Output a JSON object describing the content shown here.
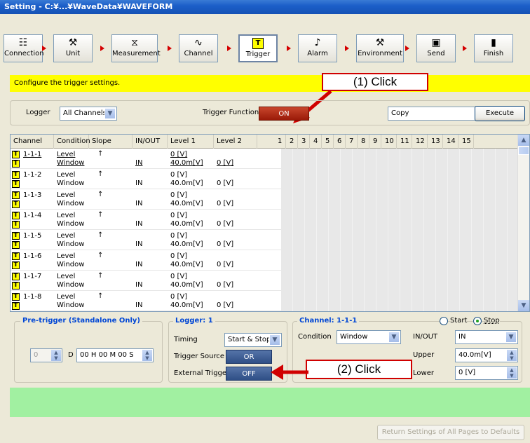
{
  "window": {
    "title": "Setting - C:¥...¥WaveData¥WAVEFORM"
  },
  "toolbar": {
    "items": [
      {
        "label": "Connection",
        "icon": "connection-icon",
        "glyph": "☷"
      },
      {
        "label": "Unit",
        "icon": "unit-icon",
        "glyph": "⚒"
      },
      {
        "label": "Measurement",
        "icon": "hourglass-icon",
        "glyph": "⧖"
      },
      {
        "label": "Channel",
        "icon": "waveform-icon",
        "glyph": "∿"
      },
      {
        "label": "Trigger",
        "icon": "trigger-icon",
        "glyph": "T"
      },
      {
        "label": "Alarm",
        "icon": "alarm-speaker-icon",
        "glyph": "♪"
      },
      {
        "label": "Environment",
        "icon": "tools-icon",
        "glyph": "⚒"
      },
      {
        "label": "Send",
        "icon": "send-icon",
        "glyph": "▣"
      },
      {
        "label": "Finish",
        "icon": "exit-door-icon",
        "glyph": "▮"
      }
    ],
    "active": "Trigger"
  },
  "banner": {
    "text": "Configure the trigger settings."
  },
  "callouts": {
    "one": "(1) Click",
    "two": "(2) Click"
  },
  "controls": {
    "logger_label": "Logger",
    "logger_value": "All Channels",
    "trigger_function_label": "Trigger Function",
    "trigger_function_value": "ON",
    "copy_value": "Copy",
    "execute_label": "Execute"
  },
  "table": {
    "headers": [
      "Channel",
      "Condition",
      "Slope",
      "IN/OUT",
      "Level 1",
      "Level 2",
      "1",
      "2",
      "3",
      "4",
      "5",
      "6",
      "7",
      "8",
      "9",
      "10",
      "11",
      "12",
      "13",
      "14",
      "15"
    ],
    "rows": [
      {
        "channel": "1-1-1",
        "cond1": "Level",
        "cond2": "Window",
        "slope": "↑",
        "inout": "IN",
        "l1a": "0 [V]",
        "l1b": "40.0m[V]",
        "l2": "0 [V]"
      },
      {
        "channel": "1-1-2",
        "cond1": "Level",
        "cond2": "Window",
        "slope": "↑",
        "inout": "IN",
        "l1a": "0 [V]",
        "l1b": "40.0m[V]",
        "l2": "0 [V]"
      },
      {
        "channel": "1-1-3",
        "cond1": "Level",
        "cond2": "Window",
        "slope": "↑",
        "inout": "IN",
        "l1a": "0 [V]",
        "l1b": "40.0m[V]",
        "l2": "0 [V]"
      },
      {
        "channel": "1-1-4",
        "cond1": "Level",
        "cond2": "Window",
        "slope": "↑",
        "inout": "IN",
        "l1a": "0 [V]",
        "l1b": "40.0m[V]",
        "l2": "0 [V]"
      },
      {
        "channel": "1-1-5",
        "cond1": "Level",
        "cond2": "Window",
        "slope": "↑",
        "inout": "IN",
        "l1a": "0 [V]",
        "l1b": "40.0m[V]",
        "l2": "0 [V]"
      },
      {
        "channel": "1-1-6",
        "cond1": "Level",
        "cond2": "Window",
        "slope": "↑",
        "inout": "IN",
        "l1a": "0 [V]",
        "l1b": "40.0m[V]",
        "l2": "0 [V]"
      },
      {
        "channel": "1-1-7",
        "cond1": "Level",
        "cond2": "Window",
        "slope": "↑",
        "inout": "IN",
        "l1a": "0 [V]",
        "l1b": "40.0m[V]",
        "l2": "0 [V]"
      },
      {
        "channel": "1-1-8",
        "cond1": "Level",
        "cond2": "Window",
        "slope": "↑",
        "inout": "IN",
        "l1a": "0 [V]",
        "l1b": "40.0m[V]",
        "l2": "0 [V]"
      }
    ]
  },
  "pretrigger": {
    "title": "Pre-trigger (Standalone Only)",
    "value": "0",
    "d_label": "D",
    "time": "00 H 00 M 00 S"
  },
  "logger": {
    "title": "Logger: 1",
    "timing_label": "Timing",
    "timing_value": "Start & Stop",
    "trigger_source_label": "Trigger Source",
    "trigger_source_value": "OR",
    "external_trigger_label": "External Trigger",
    "external_trigger_value": "OFF"
  },
  "channel_panel": {
    "title": "Channel: 1-1-1",
    "start_label": "Start",
    "stop_label": "Stop",
    "condition_label": "Condition",
    "condition_value": "Window",
    "inout_label": "IN/OUT",
    "inout_value": "IN",
    "upper_label": "Upper",
    "upper_value": "40.0m[V]",
    "lower_label": "Lower",
    "lower_value": "0 [V]"
  },
  "footer": {
    "reset_label": "Return Settings of All Pages to Defaults"
  },
  "colors": {
    "banner": "#ffff00",
    "green_area": "#a1f0a1",
    "callout_border": "#d00000",
    "on_button": "#b22a14",
    "blue_button": "#3a5a93"
  }
}
